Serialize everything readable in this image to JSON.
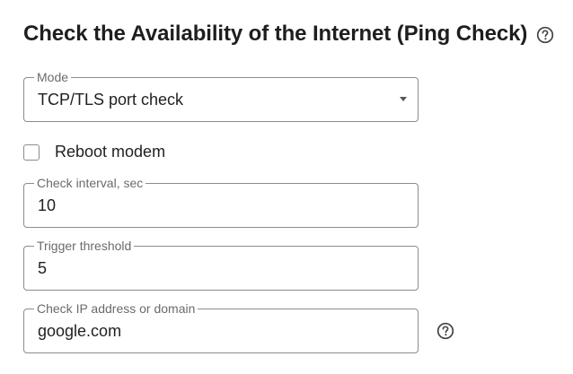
{
  "header": {
    "title": "Check the Availability of the Internet (Ping Check)",
    "help_icon": "question-circle-icon"
  },
  "mode": {
    "label": "Mode",
    "value": "TCP/TLS port check"
  },
  "reboot_modem": {
    "label": "Reboot modem",
    "checked": false
  },
  "check_interval": {
    "label": "Check interval, sec",
    "value": "10"
  },
  "trigger_threshold": {
    "label": "Trigger threshold",
    "value": "5"
  },
  "check_address": {
    "label": "Check IP address or domain",
    "value": "google.com",
    "help_icon": "question-circle-icon"
  },
  "colors": {
    "text": "#1f1f1f",
    "border": "#8c8c8c",
    "label": "#6b6b6b"
  }
}
